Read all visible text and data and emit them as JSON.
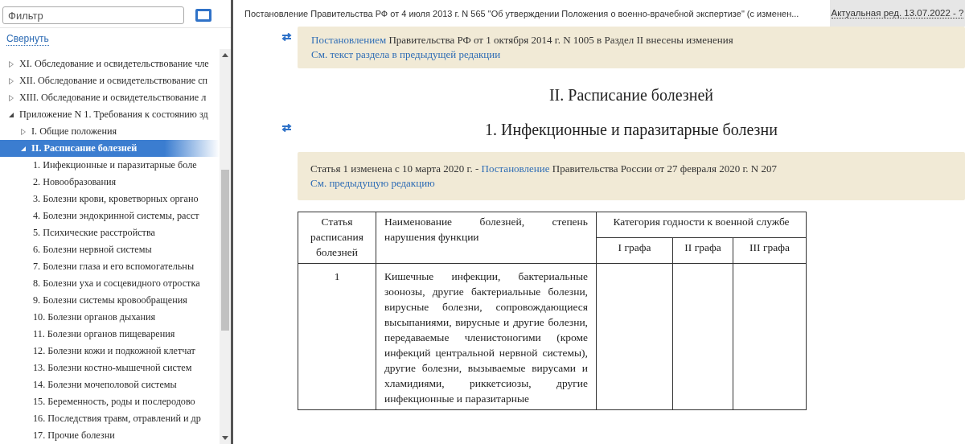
{
  "filter": {
    "placeholder": "Фильтр"
  },
  "collapse_link": "Свернуть",
  "tree": [
    {
      "label": "XI. Обследование и освидетельствование чле",
      "expanded": false,
      "selected": false
    },
    {
      "label": "XII. Обследование и освидетельствование сп",
      "expanded": false,
      "selected": false
    },
    {
      "label": "XIII. Обследование и освидетельствование л",
      "expanded": false,
      "selected": false
    },
    {
      "label": "Приложение N 1. Требования к состоянию зд",
      "expanded": true,
      "selected": false,
      "children": [
        {
          "label": "I. Общие положения",
          "expanded": false,
          "selected": false
        },
        {
          "label": "II. Расписание болезней",
          "expanded": true,
          "selected": true,
          "children": [
            {
              "label": "1. Инфекционные и паразитарные боле",
              "selected": false
            },
            {
              "label": "2. Новообразования",
              "selected": false
            },
            {
              "label": "3. Болезни крови, кроветворных органо",
              "selected": false
            },
            {
              "label": "4. Болезни эндокринной системы, расст",
              "selected": false
            },
            {
              "label": "5. Психические расстройства",
              "selected": false
            },
            {
              "label": "6. Болезни нервной системы",
              "selected": false
            },
            {
              "label": "7. Болезни глаза и его вспомогательны",
              "selected": false
            },
            {
              "label": "8. Болезни уха и сосцевидного отростка",
              "selected": false
            },
            {
              "label": "9. Болезни системы кровообращения",
              "selected": false
            },
            {
              "label": "10. Болезни органов дыхания",
              "selected": false
            },
            {
              "label": "11. Болезни органов пищеварения",
              "selected": false
            },
            {
              "label": "12. Болезни кожи и подкожной клетчат",
              "selected": false
            },
            {
              "label": "13. Болезни костно-мышечной систем",
              "selected": false
            },
            {
              "label": "14. Болезни мочеполовой системы",
              "selected": false
            },
            {
              "label": "15. Беременность, роды и послеродово",
              "selected": false
            },
            {
              "label": "16. Последствия травм, отравлений и др",
              "selected": false
            },
            {
              "label": "17. Прочие болезни",
              "selected": false
            }
          ]
        }
      ]
    }
  ],
  "document_title": "Постановление Правительства РФ от 4 июля 2013 г. N 565 \"Об утверждении Положения о военно-врачебной экспертизе\" (с изменен...",
  "edition": "Актуальная ред. 13.07.2022 - ?",
  "section_notice": {
    "lines": [
      [
        {
          "kind": "link",
          "text": "Постановлением"
        },
        {
          "kind": "text",
          "text": " Правительства РФ от 1 октября 2014 г. N 1005 в Раздел II внесены изменения"
        }
      ],
      [
        {
          "kind": "link",
          "text": "См. текст раздела в предыдущей редакции"
        }
      ]
    ]
  },
  "section_title": "II. Расписание болезней",
  "chapter_title": "1. Инфекционные и паразитарные болезни",
  "chapter_notice": {
    "lines": [
      [
        {
          "kind": "text",
          "text": "Статья 1 изменена с 10 марта 2020 г. - "
        },
        {
          "kind": "link",
          "text": "Постановление"
        },
        {
          "kind": "text",
          "text": " Правительства России от 27 февраля 2020 г. N 207"
        }
      ],
      [
        {
          "kind": "link",
          "text": "См. предыдущую редакцию"
        }
      ]
    ]
  },
  "table": {
    "columns": [
      "Статья расписания болезней",
      "Наименование болезней, степень нарушения функции"
    ],
    "group": {
      "label": "Категория годности к военной службе",
      "columns": [
        "I графа",
        "II графа",
        "III графа"
      ]
    },
    "rows": [
      {
        "article": "1",
        "name": "Кишечные инфекции, бактериальные зоонозы, другие бактериальные болезни, вирусные болезни, сопровождающиеся высыпаниями, вирусные и другие болезни, передаваемые членистоногими (кроме инфекций центральной нервной системы), другие болезни, вызываемые вирусами и хламидиями, риккетсиозы, другие инфекционные и паразитарные"
      }
    ]
  }
}
